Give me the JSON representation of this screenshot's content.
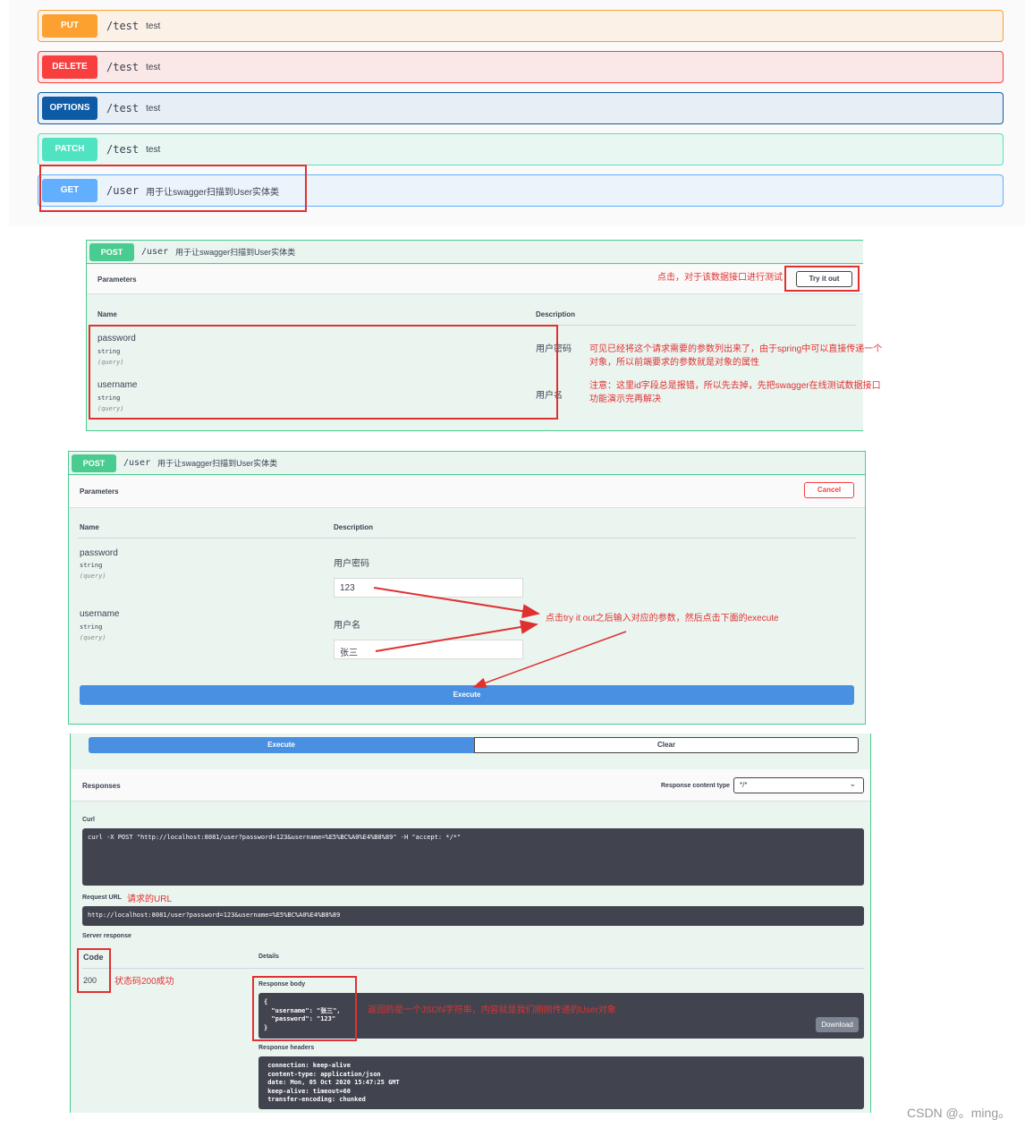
{
  "panel1": {
    "operations": [
      {
        "verb": "PUT",
        "path": "/test",
        "summary": "test"
      },
      {
        "verb": "DELETE",
        "path": "/test",
        "summary": "test"
      },
      {
        "verb": "OPTIONS",
        "path": "/test",
        "summary": "test"
      },
      {
        "verb": "PATCH",
        "path": "/test",
        "summary": "test"
      },
      {
        "verb": "GET",
        "path": "/user",
        "summary": "用于让swagger扫描到User实体类"
      }
    ]
  },
  "panel2": {
    "verb": "POST",
    "path": "/user",
    "summary": "用于让swagger扫描到User实体类",
    "parameters_title": "Parameters",
    "annotation_try": "点击，对于该数据接口进行测试",
    "try_button": "Try it out",
    "col_name": "Name",
    "col_desc": "Description",
    "params": [
      {
        "name": "password",
        "type": "string",
        "in": "(query)",
        "desc": "用户密码"
      },
      {
        "name": "username",
        "type": "string",
        "in": "(query)",
        "desc": "用户名"
      }
    ],
    "annotation_params_1": "可见已经将这个请求需要的参数列出来了，由于spring中可以直接传递一个对象，所以前端要求的参数就是对象的属性",
    "annotation_params_2": "注意：这里id字段总是报错，所以先去掉，先把swagger在线测试数据接口功能演示完再解决"
  },
  "panel3": {
    "verb": "POST",
    "path": "/user",
    "summary": "用于让swagger扫描到User实体类",
    "parameters_title": "Parameters",
    "cancel_button": "Cancel",
    "col_name": "Name",
    "col_desc": "Description",
    "params": [
      {
        "name": "password",
        "type": "string",
        "in": "(query)",
        "desc": "用户密码",
        "value": "123"
      },
      {
        "name": "username",
        "type": "string",
        "in": "(query)",
        "desc": "用户名",
        "value": "张三"
      }
    ],
    "annotation": "点击try it out之后输入对应的参数，然后点击下面的execute",
    "execute_button": "Execute"
  },
  "panel4": {
    "execute_button": "Execute",
    "clear_button": "Clear",
    "responses_title": "Responses",
    "content_type_label": "Response content type",
    "content_type_value": "*/*",
    "curl_label": "Curl",
    "curl_value": "curl -X POST \"http://localhost:8081/user?password=123&username=%E5%BC%A0%E4%B8%89\" -H \"accept: */*\"",
    "request_url_label": "Request URL",
    "request_url_annotation": "请求的URL",
    "request_url_value": "http://localhost:8081/user?password=123&username=%E5%BC%A0%E4%B8%89",
    "server_response_label": "Server response",
    "code_label": "Code",
    "details_label": "Details",
    "code_value": "200",
    "code_annotation": "状态码200成功",
    "response_body_label": "Response body",
    "response_body": "{\n  \"username\": \"张三\",\n  \"password\": \"123\"\n}",
    "response_body_annotation": "返回的是一个JSON字符串，内容就是我们刚刚传递的User对象",
    "download_button": "Download",
    "response_headers_label": "Response headers",
    "response_headers": " connection: keep-alive\n content-type: application/json\n date: Mon, 05 Oct 2020 15:47:25 GMT\n keep-alive: timeout=60\n transfer-encoding: chunked"
  },
  "watermark": "CSDN @。ming。"
}
